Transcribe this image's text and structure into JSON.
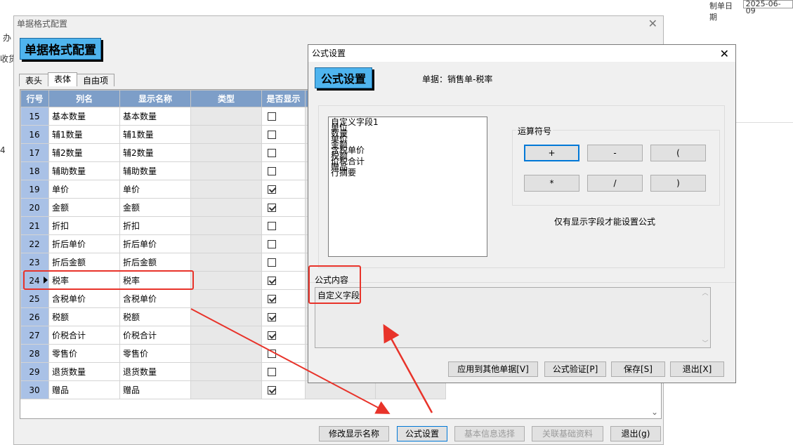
{
  "background": {
    "top_right_label": "制单日期",
    "top_right_value": "2025-06-09",
    "left_labels": [
      "办",
      "收货",
      "4"
    ]
  },
  "main_window": {
    "title": "单据格式配置",
    "header": "单据格式配置",
    "tabs": [
      "表头",
      "表体",
      "自由项"
    ],
    "active_tab": "表体",
    "columns": [
      "行号",
      "列名",
      "显示名称",
      "类型",
      "是否显示"
    ],
    "rows": [
      {
        "no": "15",
        "name": "基本数量",
        "display": "基本数量",
        "show": false
      },
      {
        "no": "16",
        "name": "辅1数量",
        "display": "辅1数量",
        "show": false
      },
      {
        "no": "17",
        "name": "辅2数量",
        "display": "辅2数量",
        "show": false
      },
      {
        "no": "18",
        "name": "辅助数量",
        "display": "辅助数量",
        "show": false
      },
      {
        "no": "19",
        "name": "单价",
        "display": "单价",
        "show": true
      },
      {
        "no": "20",
        "name": "金额",
        "display": "金额",
        "show": true
      },
      {
        "no": "21",
        "name": "折扣",
        "display": "折扣",
        "show": false
      },
      {
        "no": "22",
        "name": "折后单价",
        "display": "折后单价",
        "show": false
      },
      {
        "no": "23",
        "name": "折后金额",
        "display": "折后金额",
        "show": false
      },
      {
        "no": "24",
        "name": "税率",
        "display": "税率",
        "show": true,
        "current": true
      },
      {
        "no": "25",
        "name": "含税单价",
        "display": "含税单价",
        "show": true
      },
      {
        "no": "26",
        "name": "税额",
        "display": "税额",
        "show": true
      },
      {
        "no": "27",
        "name": "价税合计",
        "display": "价税合计",
        "show": true
      },
      {
        "no": "28",
        "name": "零售价",
        "display": "零售价",
        "show": false
      },
      {
        "no": "29",
        "name": "退货数量",
        "display": "退货数量",
        "show": false
      },
      {
        "no": "30",
        "name": "赠品",
        "display": "赠品",
        "show": true
      }
    ],
    "buttons": {
      "rename": "修改显示名称",
      "formula": "公式设置",
      "basic_info": "基本信息选择",
      "related": "关联基础资料",
      "exit": "退出(g)"
    }
  },
  "formula_dialog": {
    "title": "公式设置",
    "header": "公式设置",
    "doc_label": "单据：销售单-税率",
    "fields": [
      "自定义字段1",
      "单位",
      "数量",
      "单价",
      "金额",
      "含税单价",
      "税额",
      "价税合计",
      "赠品",
      "行摘要"
    ],
    "operators_title": "运算符号",
    "operators": [
      "+",
      "-",
      "(",
      "*",
      "/",
      ")"
    ],
    "note": "仅有显示字段才能设置公式",
    "formula_label": "公式内容",
    "formula_value": "自定义字段",
    "buttons": {
      "apply_other": "应用到其他单据[V]",
      "verify": "公式验证[P]",
      "save": "保存[S]",
      "exit": "退出[X]"
    }
  },
  "colors": {
    "header_badge": "#4fb4ee",
    "grid_header": "#7d9ec8",
    "row_number_bg": "#a9c1e6",
    "annotation": "#e8332a"
  }
}
